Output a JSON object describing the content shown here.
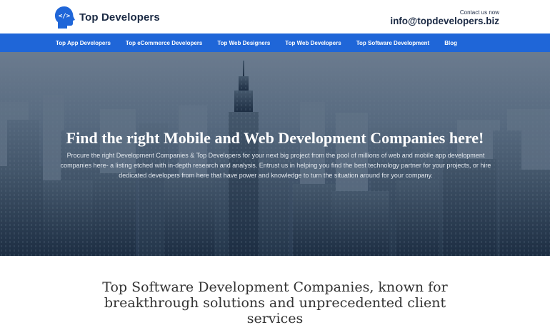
{
  "header": {
    "logo_text": "Top Developers",
    "logo_icon": "code-head-icon",
    "contact_label": "Contact us now",
    "contact_email": "info@topdevelopers.biz"
  },
  "nav": {
    "items": [
      {
        "label": "Top App Developers"
      },
      {
        "label": "Top eCommerce Developers"
      },
      {
        "label": "Top Web Designers"
      },
      {
        "label": "Top Web Developers"
      },
      {
        "label": "Top Software Development"
      },
      {
        "label": "Blog"
      }
    ]
  },
  "hero": {
    "title": "Find the right Mobile and Web Development Companies here!",
    "description_lines": [
      "Procure the right Development Companies & Top Developers for your next big project from the pool of millions of web and mobile app development",
      "companies here- a listing etched with in-depth research and analysis. Entrust us in helping you find the best technology partner for your projects, or hire",
      "dedicated developers from here that have power and knowledge to turn the situation around for your company."
    ]
  },
  "section": {
    "title_lines": [
      "Top Software Development Companies, known for",
      "breakthrough solutions and unprecedented client",
      "services"
    ]
  },
  "colors": {
    "nav_bg": "#1f66d8",
    "logo_blue": "#1f66d8",
    "brand_text": "#1b2a44"
  }
}
